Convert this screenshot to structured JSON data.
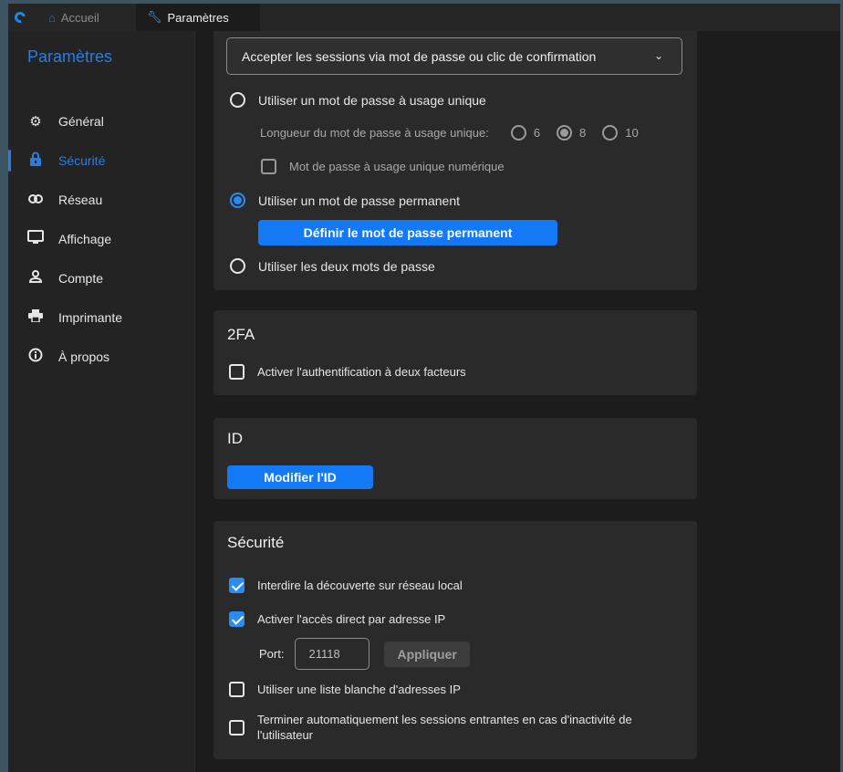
{
  "tabs": {
    "home_label": "Accueil",
    "settings_label": "Paramètres"
  },
  "sidebar": {
    "title": "Paramètres",
    "items": [
      {
        "label": "Général",
        "icon": "gear-icon"
      },
      {
        "label": "Sécurité",
        "icon": "lock-icon"
      },
      {
        "label": "Réseau",
        "icon": "link-icon"
      },
      {
        "label": "Affichage",
        "icon": "monitor-icon"
      },
      {
        "label": "Compte",
        "icon": "user-icon"
      },
      {
        "label": "Imprimante",
        "icon": "printer-icon"
      },
      {
        "label": "À propos",
        "icon": "info-icon"
      }
    ],
    "active_index": 1
  },
  "password": {
    "select_value": "Accepter les sessions via mot de passe ou clic de confirmation",
    "one_time_label": "Utiliser un mot de passe à usage unique",
    "length_label": "Longueur du mot de passe à usage unique:",
    "length_options": [
      "6",
      "8",
      "10"
    ],
    "length_selected": "8",
    "numeric_label": "Mot de passe à usage unique numérique",
    "permanent_label": "Utiliser un mot de passe permanent",
    "set_permanent_button": "Définir le mot de passe permanent",
    "both_label": "Utiliser les deux mots de passe",
    "mode_selected": "permanent"
  },
  "twofa": {
    "title": "2FA",
    "enable_label": "Activer l'authentification à deux facteurs",
    "enabled": false
  },
  "id_section": {
    "title": "ID",
    "modify_button": "Modifier l'ID"
  },
  "security": {
    "title": "Sécurité",
    "deny_lan_label": "Interdire la découverte sur réseau local",
    "deny_lan": true,
    "direct_ip_label": "Activer l'accès direct par adresse IP",
    "direct_ip": true,
    "port_label": "Port:",
    "port_value": "21118",
    "apply_button": "Appliquer",
    "whitelist_label": "Utiliser une liste blanche d'adresses IP",
    "whitelist": false,
    "auto_close_label": "Terminer automatiquement les sessions entrantes en cas d'inactivité de l'utilisateur",
    "auto_close": false
  },
  "colors": {
    "accent": "#2a7de0",
    "button_primary": "#1479f5",
    "background": "#1c1c1c",
    "card": "#2a2a2a"
  }
}
